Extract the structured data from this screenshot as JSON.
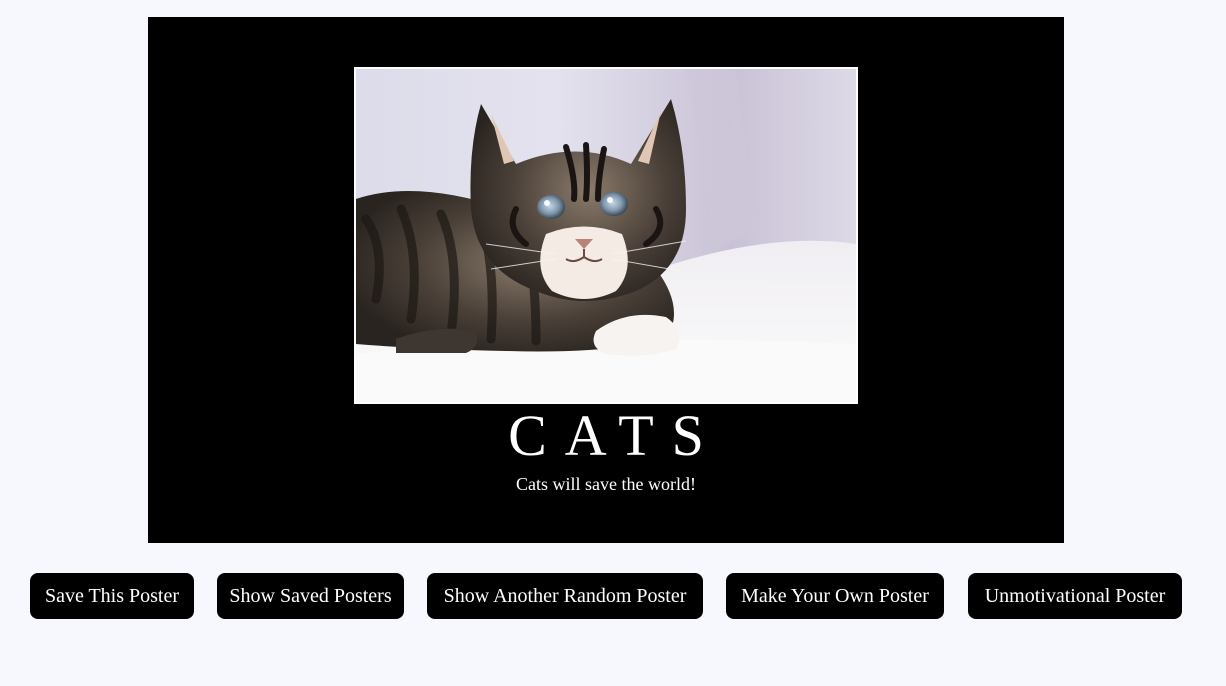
{
  "poster": {
    "image_subject": "tabby-kitten-photo",
    "title": "CATS",
    "quote": "Cats will save the world!"
  },
  "controls": {
    "save_label": "Save This Poster",
    "show_saved_label": "Show Saved Posters",
    "random_label": "Show Another Random Poster",
    "make_own_label": "Make Your Own Poster",
    "unmotivational_label": "Unmotivational Poster"
  },
  "colors": {
    "page_background": "#f7f8fd",
    "poster_background": "#000000",
    "button_background": "#000000",
    "text_light": "#ffffff"
  }
}
